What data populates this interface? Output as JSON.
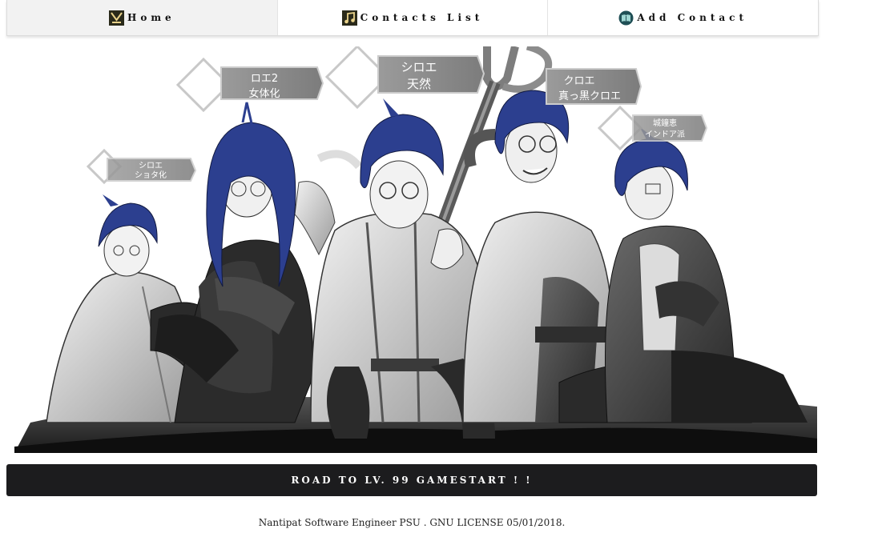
{
  "nav": {
    "items": [
      {
        "label": "Home",
        "icon": "guild-crest-icon",
        "active": true
      },
      {
        "label": "Contacts List",
        "icon": "music-note-icon",
        "active": false
      },
      {
        "label": "Add Contact",
        "icon": "book-icon",
        "active": false
      }
    ]
  },
  "hero": {
    "tags": [
      {
        "line1": "シロエ",
        "line2": "ショタ化"
      },
      {
        "line1": "ロエ2",
        "line2": "女体化"
      },
      {
        "line1": "シロエ",
        "line2": "天然"
      },
      {
        "line1": "クロエ",
        "line2": "真っ黒クロエ"
      },
      {
        "line1": "城鐘恵",
        "line2": "インドア派"
      }
    ]
  },
  "start_button": {
    "label": "ROAD TO LV. 99 GAMESTART ! !"
  },
  "footer": {
    "text": "Nantipat Software Engineer PSU . GNU LICENSE 05/01/2018."
  },
  "colors": {
    "hair": "#2c3f8f",
    "banner": "#1c1c1e"
  }
}
